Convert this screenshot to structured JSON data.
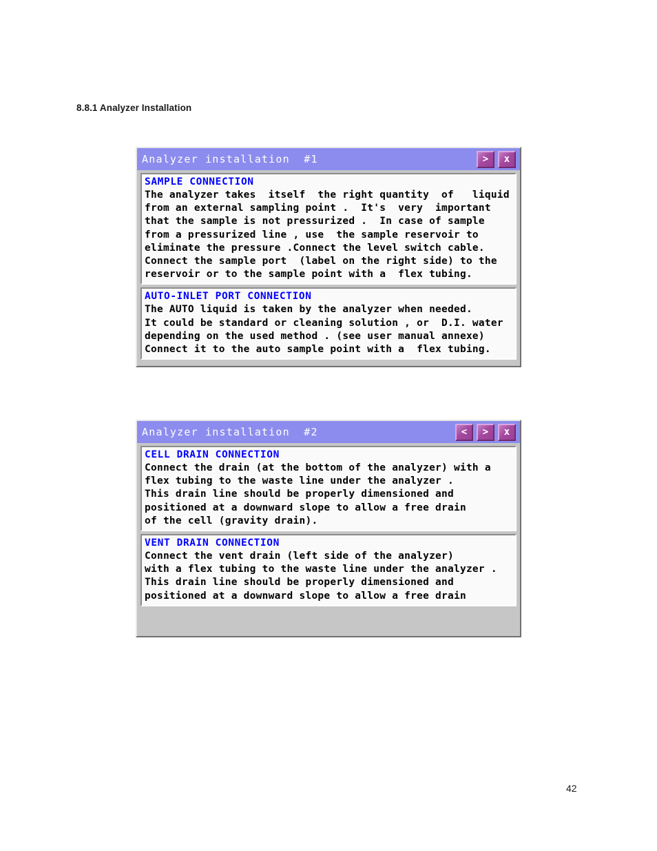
{
  "document": {
    "heading": "8.8.1 Analyzer Installation",
    "page_number": "42"
  },
  "theme": {
    "titlebar_bg": "#8c8cee",
    "titlebar_text": "#ffffff",
    "button_face": "#a4499f",
    "panel_heading_color": "#0000ff",
    "panel_bg": "#fafafa",
    "window_bg": "#c6c6c6"
  },
  "dialogs": [
    {
      "title": "Analyzer installation  #1",
      "buttons": [
        {
          "name": "next",
          "glyph": ">"
        },
        {
          "name": "close",
          "glyph": "x"
        }
      ],
      "panels": [
        {
          "heading": "SAMPLE CONNECTION",
          "body": "The analyzer takes  itself  the right quantity  of   liquid\nfrom an external sampling point .  It's  very  important\nthat the sample is not pressurized .  In case of sample\nfrom a pressurized line , use  the sample reservoir to\neliminate the pressure .Connect the level switch cable.\nConnect the sample port  (label on the right side) to the\nreservoir or to the sample point with a  flex tubing."
        },
        {
          "heading": "AUTO-INLET PORT CONNECTION",
          "body": "The AUTO liquid is taken by the analyzer when needed.\nIt could be standard or cleaning solution , or  D.I. water\ndepending on the used method . (see user manual annexe)\nConnect it to the auto sample point with a  flex tubing."
        }
      ]
    },
    {
      "title": "Analyzer installation  #2",
      "buttons": [
        {
          "name": "previous",
          "glyph": "<"
        },
        {
          "name": "next",
          "glyph": ">"
        },
        {
          "name": "close",
          "glyph": "x"
        }
      ],
      "panels": [
        {
          "heading": "CELL DRAIN CONNECTION",
          "body": "Connect the drain (at the bottom of the analyzer) with a\nflex tubing to the waste line under the analyzer .\nThis drain line should be properly dimensioned and\npositioned at a downward slope to allow a free drain\nof the cell (gravity drain)."
        },
        {
          "heading": "VENT DRAIN CONNECTION",
          "body": "Connect the vent drain (left side of the analyzer)\nwith a flex tubing to the waste line under the analyzer .\nThis drain line should be properly dimensioned and\npositioned at a downward slope to allow a free drain"
        }
      ]
    }
  ]
}
